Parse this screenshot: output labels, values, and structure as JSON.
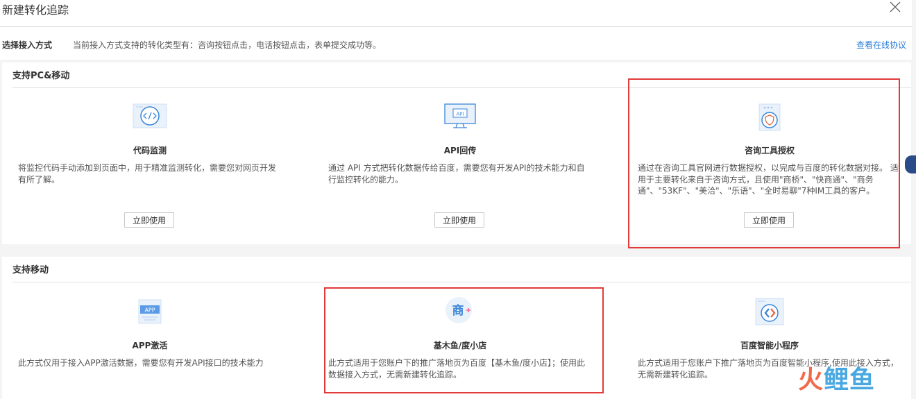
{
  "header": {
    "title": "新建转化追踪",
    "close_icon": "close-icon"
  },
  "method": {
    "label": "选择接入方式",
    "description": "当前接入方式支持的转化类型有：咨询按钮点击，电话按钮点击，表单提交成功等。",
    "protocol_link": "查看在线协议"
  },
  "pc_section": {
    "title": "支持PC&移动",
    "cards": [
      {
        "icon": "code-icon",
        "title": "代码监测",
        "desc": "将监控代码手动添加到页面中，用于精准监测转化，需要您对网页开发有所了解。",
        "button": "立即使用"
      },
      {
        "icon": "api-icon",
        "title": "API回传",
        "desc": "通过 API 方式把转化数据传给百度，需要您有开发API的技术能力和自行监控转化的能力。",
        "button": "立即使用"
      },
      {
        "icon": "shield-icon",
        "title": "咨询工具授权",
        "desc": "通过在咨询工具官网进行数据授权，以完成与百度的转化数据对接。 适用于主要转化来自于咨询方式，且使用\"商桥\"、\"快商通\"、\"商务通\"、\"53KF\"、\"美洽\"、\"乐语\"、\"全时易聊\"7种IM工具的客户。",
        "button": "立即使用"
      }
    ]
  },
  "mobile_section": {
    "title": "支持移动",
    "cards": [
      {
        "icon": "app-icon",
        "title": "APP激活",
        "desc": "此方式仅用于接入APP激活数据，需要您有开发API接口的技术能力"
      },
      {
        "icon": "shop-icon",
        "icon_text": "商",
        "title": "基木鱼/度小店",
        "desc": "此方式适用于您账户下的推广落地页为百度【基木鱼/度小店】；使用此数据接入方式，无需新建转化追踪。"
      },
      {
        "icon": "mini-program-icon",
        "title": "百度智能小程序",
        "desc": "此方式适用于您账户下推广落地页为百度智能小程序,使用此接入方式，无需新建转化追踪。"
      }
    ]
  },
  "watermark": {
    "part1": "火",
    "part2": "鲤鱼"
  },
  "colors": {
    "accent": "#2b7bd6",
    "highlight": "#e23a3a",
    "icon_bg": "#e9f1fb"
  }
}
